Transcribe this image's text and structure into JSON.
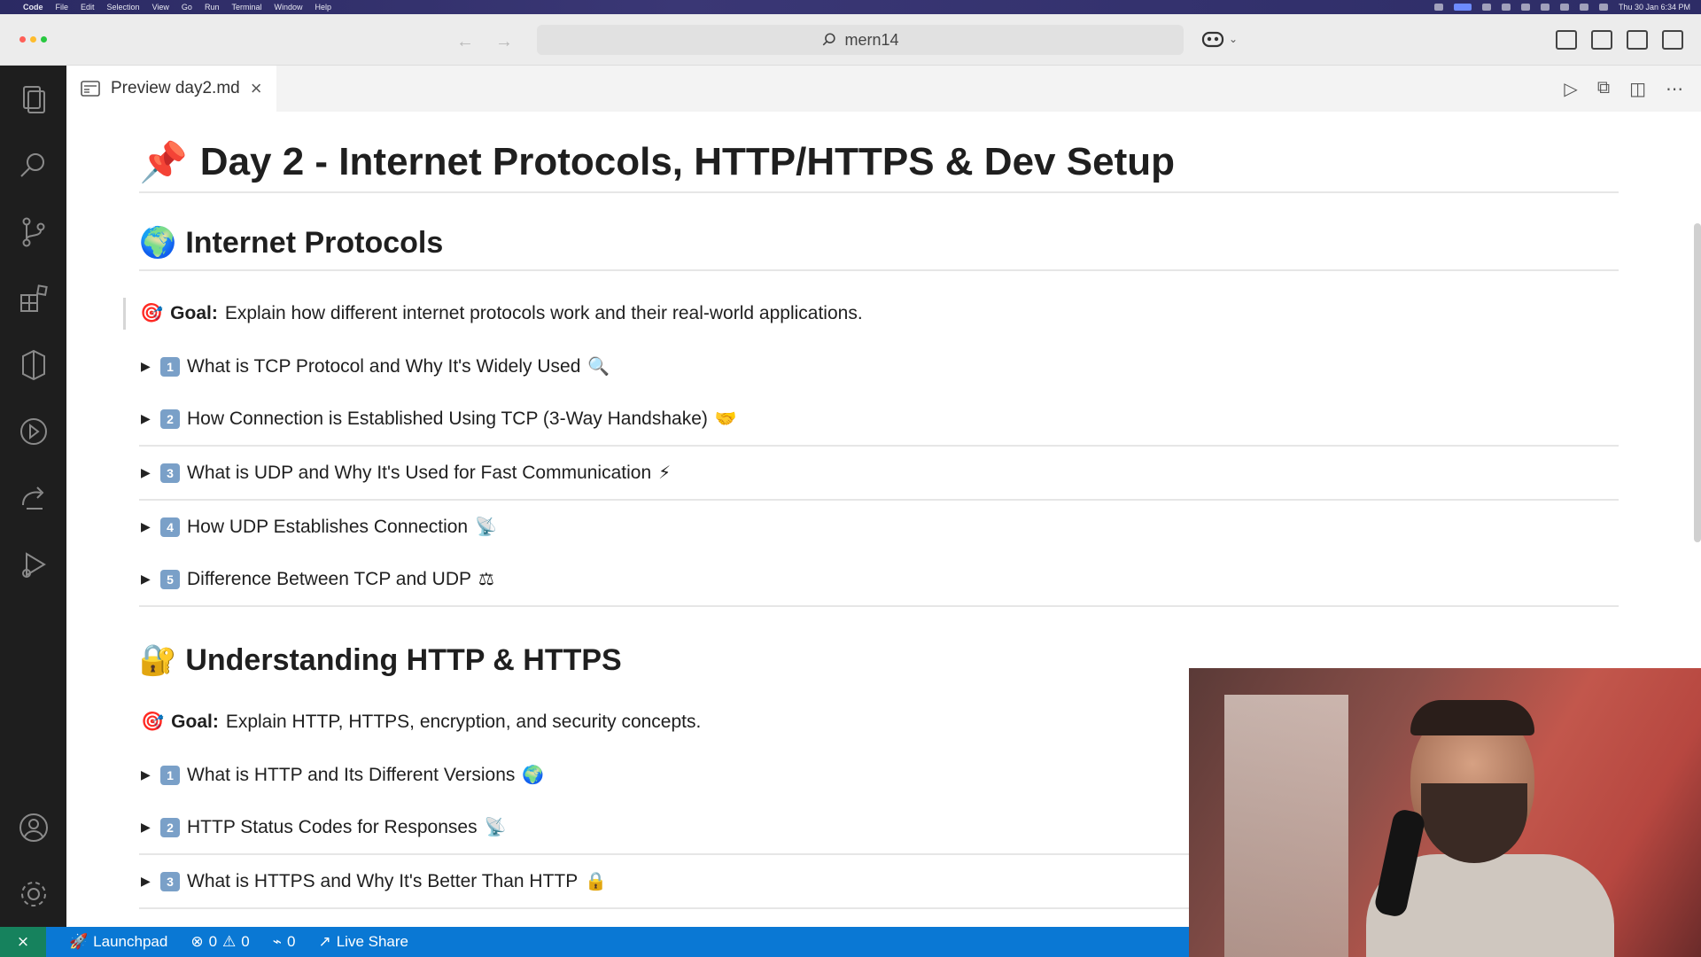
{
  "menubar": {
    "app_name": "Code",
    "menus": [
      "File",
      "Edit",
      "Selection",
      "View",
      "Go",
      "Run",
      "Terminal",
      "Window",
      "Help"
    ],
    "clock": "Thu 30 Jan 6:34 PM"
  },
  "titlebar": {
    "search_text": "mern14",
    "traffic_colors": [
      "#ff5f57",
      "#febc2e",
      "#28c840"
    ]
  },
  "tab": {
    "label": "Preview day2.md"
  },
  "document": {
    "title_emoji": "📌",
    "title": "Day 2 - Internet Protocols, HTTP/HTTPS & Dev Setup",
    "sections": [
      {
        "emoji": "🌍",
        "heading": "Internet Protocols",
        "goal_label": "Goal:",
        "goal_text": "Explain how different internet protocols work and their real-world applications.",
        "items": [
          {
            "num": "1",
            "text": "What is TCP Protocol and Why It's Widely Used",
            "suffix": "🔍"
          },
          {
            "num": "2",
            "text": "How Connection is Established Using TCP (3-Way Handshake)",
            "suffix": "🤝"
          },
          {
            "num": "3",
            "text": "What is UDP and Why It's Used for Fast Communication",
            "suffix": "⚡"
          },
          {
            "num": "4",
            "text": "How UDP Establishes Connection",
            "suffix": "📡"
          },
          {
            "num": "5",
            "text": "Difference Between TCP and UDP",
            "suffix": "⚖"
          }
        ]
      },
      {
        "emoji": "🔐",
        "heading": "Understanding HTTP & HTTPS",
        "goal_label": "Goal:",
        "goal_text": "Explain HTTP, HTTPS, encryption, and security concepts.",
        "items": [
          {
            "num": "1",
            "text": "What is HTTP and Its Different Versions",
            "suffix": "🌍"
          },
          {
            "num": "2",
            "text": "HTTP Status Codes for Responses",
            "suffix": "📡"
          },
          {
            "num": "3",
            "text": "What is HTTPS and Why It's Better Than HTTP",
            "suffix": "🔒"
          }
        ]
      }
    ]
  },
  "statusbar": {
    "launchpad": "Launchpad",
    "errors": "0",
    "warnings": "0",
    "ports": "0",
    "live_share": "Live Share"
  },
  "colors": {
    "status_blue": "#0a78d4",
    "activity_bg": "#1e1e1e",
    "remote_green": "#16825d"
  }
}
